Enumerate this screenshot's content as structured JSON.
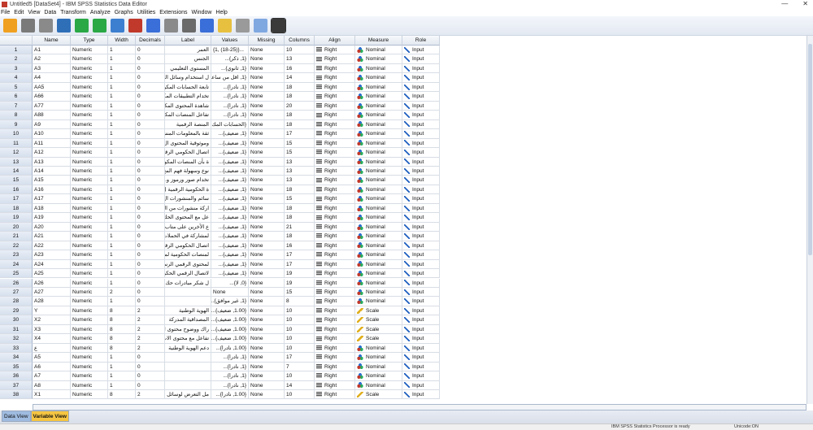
{
  "window": {
    "title": "Untitled5 [DataSet4] - IBM SPSS Statistics Data Editor",
    "minimize": "—",
    "close": "✕"
  },
  "menu": [
    "File",
    "Edit",
    "View",
    "Data",
    "Transform",
    "Analyze",
    "Graphs",
    "Utilities",
    "Extensions",
    "Window",
    "Help"
  ],
  "toolbar": [
    "open-icon",
    "save-icon",
    "print-icon",
    "dialog-recall-icon",
    "undo-icon",
    "redo-icon",
    "goto-case-icon",
    "goto-variable-icon",
    "variables-icon",
    "find-blank-icon",
    "find-icon",
    "insert-cases-icon",
    "insert-variable-icon",
    "split-file-icon",
    "select-cases-icon",
    "value-labels-icon"
  ],
  "colors": {
    "toolbar": [
      "#f0a020",
      "#7a7a7a",
      "#8a8a8a",
      "#2f6fb8",
      "#2aa845",
      "#2aa845",
      "#3c7fd0",
      "#c0392b",
      "#3a6ed8",
      "#8a8a8a",
      "#6a6a6a",
      "#3a6ed8",
      "#e8c040",
      "#9a9a9a",
      "#7fa8e0",
      "#3a3a3a"
    ]
  },
  "columns": [
    "Name",
    "Type",
    "Width",
    "Decimals",
    "Label",
    "Values",
    "Missing",
    "Columns",
    "Align",
    "Measure",
    "Role"
  ],
  "rows": [
    [
      "1",
      "A1",
      "Numeric",
      "1",
      "0",
      "العمر",
      "{1, (18-25)}...",
      "None",
      "10",
      "Right",
      "Nominal",
      "Input"
    ],
    [
      "2",
      "A2",
      "Numeric",
      "1",
      "0",
      "الجنس",
      "{1, ذكر}...",
      "None",
      "13",
      "Right",
      "Nominal",
      "Input"
    ],
    [
      "3",
      "A3",
      "Numeric",
      "1",
      "0",
      "المستوى التعليمي",
      "{1, ثانوي}...",
      "None",
      "16",
      "Right",
      "Nominal",
      "Input"
    ],
    [
      "4",
      "A4",
      "Numeric",
      "1",
      "0",
      "ل استخدام وسائل الت...",
      "{1, اقل من ساعة}...",
      "None",
      "14",
      "Right",
      "Nominal",
      "Input"
    ],
    [
      "5",
      "AA5",
      "Numeric",
      "1",
      "0",
      "تابعة الحسابات المكو...",
      "{1, نادرا}...",
      "None",
      "18",
      "Right",
      "Nominal",
      "Input"
    ],
    [
      "6",
      "A66",
      "Numeric",
      "1",
      "0",
      "تخدام التطبيقات المكو...",
      "{1, نادرا}...",
      "None",
      "18",
      "Right",
      "Nominal",
      "Input"
    ],
    [
      "7",
      "A77",
      "Numeric",
      "1",
      "0",
      "شاهدة المحتوى المكو...",
      "{1, نادرا}...",
      "None",
      "20",
      "Right",
      "Nominal",
      "Input"
    ],
    [
      "8",
      "A88",
      "Numeric",
      "1",
      "0",
      "تفاعل المنصات المكو...",
      "{1, نادرا}...",
      "None",
      "18",
      "Right",
      "Nominal",
      "Input"
    ],
    [
      "9",
      "A9",
      "Numeric",
      "1",
      "0",
      "المنصة الرقمية",
      "{الحسابات المك...",
      "None",
      "18",
      "Right",
      "Nominal",
      "Input"
    ],
    [
      "10",
      "A10",
      "Numeric",
      "1",
      "0",
      "ثقة بالمعلومات المنشو...",
      "{1, ضعيف}...",
      "None",
      "17",
      "Right",
      "Nominal",
      "Input"
    ],
    [
      "11",
      "A11",
      "Numeric",
      "1",
      "0",
      "وموثوقية المحتوى ال...",
      "{1, ضعيف}...",
      "None",
      "15",
      "Right",
      "Nominal",
      "Input"
    ],
    [
      "12",
      "A12",
      "Numeric",
      "1",
      "0",
      "اتصال الحكومي الرقم...",
      "{1, ضعيف}...",
      "None",
      "15",
      "Right",
      "Nominal",
      "Input"
    ],
    [
      "13",
      "A13",
      "Numeric",
      "1",
      "0",
      "ة بأن المنصات المكو...",
      "{1, ضعيف}...",
      "None",
      "13",
      "Right",
      "Nominal",
      "Input"
    ],
    [
      "14",
      "A14",
      "Numeric",
      "1",
      "0",
      "نوع وسهولة فهم المح...",
      "{1, ضعيف}...",
      "None",
      "13",
      "Right",
      "Nominal",
      "Input"
    ],
    [
      "15",
      "A15",
      "Numeric",
      "1",
      "0",
      "تخدام صور ورموز و...",
      "{1, ضعيف}...",
      "None",
      "13",
      "Right",
      "Nominal",
      "Input"
    ],
    [
      "16",
      "A16",
      "Numeric",
      "1",
      "0",
      "ة الحكومية الرقمية ل...",
      "{1, ضعيف}...",
      "None",
      "18",
      "Right",
      "Nominal",
      "Input"
    ],
    [
      "17",
      "A17",
      "Numeric",
      "1",
      "0",
      "سائم والمنشورات ال...",
      "{1, ضعيف}...",
      "None",
      "15",
      "Right",
      "Nominal",
      "Input"
    ],
    [
      "18",
      "A18",
      "Numeric",
      "1",
      "0",
      "اركة منشورات من ال...",
      "{1, ضعيف}...",
      "None",
      "18",
      "Right",
      "Nominal",
      "Input"
    ],
    [
      "19",
      "A19",
      "Numeric",
      "1",
      "0",
      "عل مع المحتوى الحك...",
      "{1, ضعيف}...",
      "None",
      "18",
      "Right",
      "Nominal",
      "Input"
    ],
    [
      "20",
      "A20",
      "Numeric",
      "1",
      "0",
      "ع الأخرين على متاب...",
      "{1, ضعيف}...",
      "None",
      "21",
      "Right",
      "Nominal",
      "Input"
    ],
    [
      "21",
      "A21",
      "Numeric",
      "1",
      "0",
      "لمشاركة في الحملات ...",
      "{1, ضعيف}...",
      "None",
      "18",
      "Right",
      "Nominal",
      "Input"
    ],
    [
      "22",
      "A22",
      "Numeric",
      "1",
      "0",
      "اتصال الحكومي الرقم...",
      "{1, ضعيف}...",
      "None",
      "16",
      "Right",
      "Nominal",
      "Input"
    ],
    [
      "23",
      "A23",
      "Numeric",
      "1",
      "0",
      "لمنصات الحكومية لما...",
      "{1, ضعيف}...",
      "None",
      "17",
      "Right",
      "Nominal",
      "Input"
    ],
    [
      "24",
      "A24",
      "Numeric",
      "1",
      "0",
      "لمحتوى الرقمي الرسم...",
      "{1, ضعيف}...",
      "None",
      "17",
      "Right",
      "Nominal",
      "Input"
    ],
    [
      "25",
      "A25",
      "Numeric",
      "1",
      "0",
      "لاتصال الرقمي الحكو...",
      "{1, ضعيف}...",
      "None",
      "19",
      "Right",
      "Nominal",
      "Input"
    ],
    [
      "26",
      "A26",
      "Numeric",
      "1",
      "0",
      "ل شكر مبادرات حك...",
      "{0, لا}...",
      "None",
      "19",
      "Right",
      "Nominal",
      "Input"
    ],
    [
      "27",
      "A27",
      "Numeric",
      "2",
      "0",
      "",
      "None",
      "None",
      "15",
      "Right",
      "Nominal",
      "Input"
    ],
    [
      "28",
      "A28",
      "Numeric",
      "1",
      "0",
      "",
      "{1, غير موافق}...",
      "None",
      "8",
      "Right",
      "Nominal",
      "Input"
    ],
    [
      "29",
      "Y",
      "Numeric",
      "8",
      "2",
      "الهوية الوطنية",
      "{1.00, ضعيف}...",
      "None",
      "10",
      "Right",
      "Scale",
      "Input"
    ],
    [
      "30",
      "X2",
      "Numeric",
      "8",
      "2",
      "المصداقية المدركة",
      "{1.00, ضعيف}...",
      "None",
      "10",
      "Right",
      "Scale",
      "Input"
    ],
    [
      "31",
      "X3",
      "Numeric",
      "8",
      "2",
      "راك ووضوح محتوى !...",
      "{1.00, ضعيف}...",
      "None",
      "10",
      "Right",
      "Scale",
      "Input"
    ],
    [
      "32",
      "X4",
      "Numeric",
      "8",
      "2",
      "تفاعل مع محتوى الات...",
      "{1.00, ضعيف}...",
      "None",
      "10",
      "Right",
      "Scale",
      "Input"
    ],
    [
      "33",
      "ع",
      "Numeric",
      "8",
      "2",
      "دعم الهوية الوطنية",
      "{1.00, نادرا}...",
      "None",
      "10",
      "Right",
      "Nominal",
      "Input"
    ],
    [
      "34",
      "A5",
      "Numeric",
      "1",
      "0",
      "",
      "{1, نادرا}...",
      "None",
      "17",
      "Right",
      "Nominal",
      "Input"
    ],
    [
      "35",
      "A6",
      "Numeric",
      "1",
      "0",
      "",
      "{1, نادرا}...",
      "None",
      "7",
      "Right",
      "Nominal",
      "Input"
    ],
    [
      "36",
      "A7",
      "Numeric",
      "1",
      "0",
      "",
      "{1, نادرا}...",
      "None",
      "10",
      "Right",
      "Nominal",
      "Input"
    ],
    [
      "37",
      "A8",
      "Numeric",
      "1",
      "0",
      "",
      "{1, نادرا}...",
      "None",
      "14",
      "Right",
      "Nominal",
      "Input"
    ],
    [
      "38",
      "X1",
      "Numeric",
      "8",
      "2",
      "مل التعرض لوسائل !...",
      "{1.00, نادرا}...",
      "None",
      "10",
      "Right",
      "Scale",
      "Input"
    ]
  ],
  "tabs": {
    "data_view": "Data View",
    "variable_view": "Variable View"
  },
  "status": {
    "processor": "IBM SPSS Statistics Processor is ready",
    "unicode": "Unicode:ON"
  }
}
